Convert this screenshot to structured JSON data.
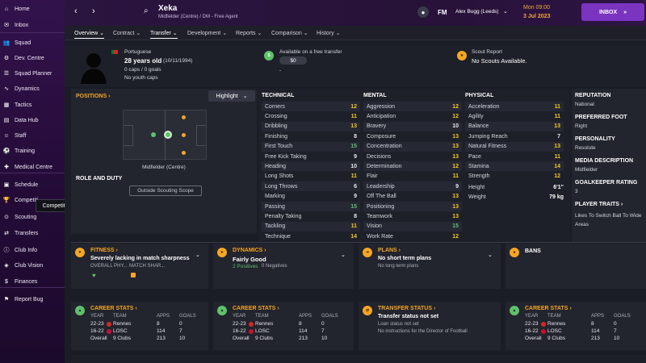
{
  "sidebar": {
    "items": [
      {
        "label": "Home",
        "icon": "home-icon"
      },
      {
        "label": "Inbox",
        "icon": "inbox-icon"
      },
      {
        "label": "Squad",
        "icon": "squad-icon"
      },
      {
        "label": "Dev. Centre",
        "icon": "dev-centre-icon"
      },
      {
        "label": "Squad Planner",
        "icon": "squad-planner-icon"
      },
      {
        "label": "Dynamics",
        "icon": "dynamics-icon"
      },
      {
        "label": "Tactics",
        "icon": "tactics-icon"
      },
      {
        "label": "Data Hub",
        "icon": "data-hub-icon"
      },
      {
        "label": "Staff",
        "icon": "staff-icon"
      },
      {
        "label": "Training",
        "icon": "training-icon"
      },
      {
        "label": "Medical Centre",
        "icon": "medical-icon"
      },
      {
        "label": "Schedule",
        "icon": "schedule-icon"
      },
      {
        "label": "Competiti",
        "icon": "trophy-icon"
      },
      {
        "label": "Scouting",
        "icon": "scouting-icon"
      },
      {
        "label": "Transfers",
        "icon": "transfers-icon"
      },
      {
        "label": "Club Info",
        "icon": "club-info-icon"
      },
      {
        "label": "Club Vision",
        "icon": "club-vision-icon"
      },
      {
        "label": "Finances",
        "icon": "finances-icon"
      },
      {
        "label": "Report Bug",
        "icon": "report-bug-icon"
      }
    ],
    "tooltip": "Competitions"
  },
  "topbar": {
    "name": "Xeka",
    "role": "Midfielder (Centre) / DM - Free Agent",
    "fm": "FM",
    "user": "Alex Bugg (Leeds)",
    "time": "Mon 09:00",
    "date": "3 Jul 2023",
    "inbox": "INBOX"
  },
  "tabs": [
    "Overview",
    "Contract",
    "Transfer",
    "Development",
    "Reports",
    "Comparison",
    "History"
  ],
  "profile": {
    "nationality": "Portuguese",
    "age": "28 years old",
    "dob": "(10/11/1994)",
    "caps": "0 caps / 0 goals",
    "youth": "No youth caps",
    "transfer_label": "Available on a free transfer",
    "fee": "$0",
    "fee_sub": "-",
    "scout_label": "Scout Report",
    "scout_value": "No Scouts Available."
  },
  "positions": {
    "title": "POSITIONS",
    "highlight": "Highlight",
    "position_name": "Midfielder (Centre)",
    "role_duty": "ROLE AND DUTY",
    "scope_button": "Outside Scouting Scope"
  },
  "technical": {
    "title": "TECHNICAL",
    "attrs": [
      {
        "name": "Corners",
        "value": "12"
      },
      {
        "name": "Crossing",
        "value": "11"
      },
      {
        "name": "Dribbling",
        "value": "13"
      },
      {
        "name": "Finishing",
        "value": "8"
      },
      {
        "name": "First Touch",
        "value": "15"
      },
      {
        "name": "Free Kick Taking",
        "value": "9"
      },
      {
        "name": "Heading",
        "value": "10"
      },
      {
        "name": "Long Shots",
        "value": "11"
      },
      {
        "name": "Long Throws",
        "value": "6"
      },
      {
        "name": "Marking",
        "value": "9"
      },
      {
        "name": "Passing",
        "value": "15"
      },
      {
        "name": "Penalty Taking",
        "value": "8"
      },
      {
        "name": "Tackling",
        "value": "11"
      },
      {
        "name": "Technique",
        "value": "14"
      }
    ]
  },
  "mental": {
    "title": "MENTAL",
    "attrs": [
      {
        "name": "Aggression",
        "value": "12"
      },
      {
        "name": "Anticipation",
        "value": "12"
      },
      {
        "name": "Bravery",
        "value": "10"
      },
      {
        "name": "Composure",
        "value": "13"
      },
      {
        "name": "Concentration",
        "value": "13"
      },
      {
        "name": "Decisions",
        "value": "13"
      },
      {
        "name": "Determination",
        "value": "12"
      },
      {
        "name": "Flair",
        "value": "11"
      },
      {
        "name": "Leadership",
        "value": "9"
      },
      {
        "name": "Off The Ball",
        "value": "13"
      },
      {
        "name": "Positioning",
        "value": "13"
      },
      {
        "name": "Teamwork",
        "value": "13"
      },
      {
        "name": "Vision",
        "value": "15"
      },
      {
        "name": "Work Rate",
        "value": "12"
      }
    ]
  },
  "physical": {
    "title": "PHYSICAL",
    "attrs": [
      {
        "name": "Acceleration",
        "value": "11"
      },
      {
        "name": "Agility",
        "value": "11"
      },
      {
        "name": "Balance",
        "value": "13"
      },
      {
        "name": "Jumping Reach",
        "value": "7"
      },
      {
        "name": "Natural Fitness",
        "value": "13"
      },
      {
        "name": "Pace",
        "value": "11"
      },
      {
        "name": "Stamina",
        "value": "14"
      },
      {
        "name": "Strength",
        "value": "12"
      }
    ],
    "height_label": "Height",
    "height": "6'1\"",
    "weight_label": "Weight",
    "weight": "79 kg"
  },
  "info": {
    "reputation_label": "REPUTATION",
    "reputation": "National",
    "foot_label": "PREFERRED FOOT",
    "foot": "Right",
    "personality_label": "PERSONALITY",
    "personality": "Resolute",
    "media_label": "MEDIA DESCRIPTION",
    "media": "Midfielder",
    "gk_label": "GOALKEEPER RATING",
    "gk": "3",
    "traits_label": "PLAYER TRAITS",
    "traits": "Likes To Switch Ball To Wide Areas"
  },
  "fitness": {
    "title": "FITNESS",
    "status": "Severely lacking in match sharpness",
    "col1": "OVERALL PHY...",
    "col2": "MATCH SHAR..."
  },
  "dynamics": {
    "title": "DYNAMICS",
    "value": "Fairly Good",
    "positives": "2 Positives",
    "negatives": "0 Negatives"
  },
  "plans": {
    "title": "PLANS",
    "value": "No short term plans",
    "sub": "No long term plans"
  },
  "bans": {
    "title": "BANS"
  },
  "career": {
    "title": "CAREER STATS",
    "year_h": "YEAR",
    "team_h": "TEAM",
    "apps_h": "APPS",
    "goals_h": "GOALS",
    "rows": [
      {
        "year": "22-23",
        "team": "Rennes",
        "apps": "8",
        "goals": "0"
      },
      {
        "year": "16-22",
        "team": "LOSC",
        "apps": "114",
        "goals": "7"
      },
      {
        "year": "Overall",
        "team": "9 Clubs",
        "apps": "213",
        "goals": "10"
      }
    ],
    "rows_alt": [
      {
        "year": "22-23",
        "team": "Rennes",
        "apps": "8",
        "goals": "0"
      },
      {
        "year": "16-22",
        "team": "LOSC",
        "apps": "114",
        "goals": "7"
      },
      {
        "year": "Overall",
        "team": "9 Clubs",
        "apps": "213",
        "goals": "10"
      }
    ]
  },
  "transfer_status": {
    "title": "TRANSFER STATUS",
    "value": "Transfer status not set",
    "loan": "Loan status not set",
    "note": "No instructions for the Director of Football"
  }
}
